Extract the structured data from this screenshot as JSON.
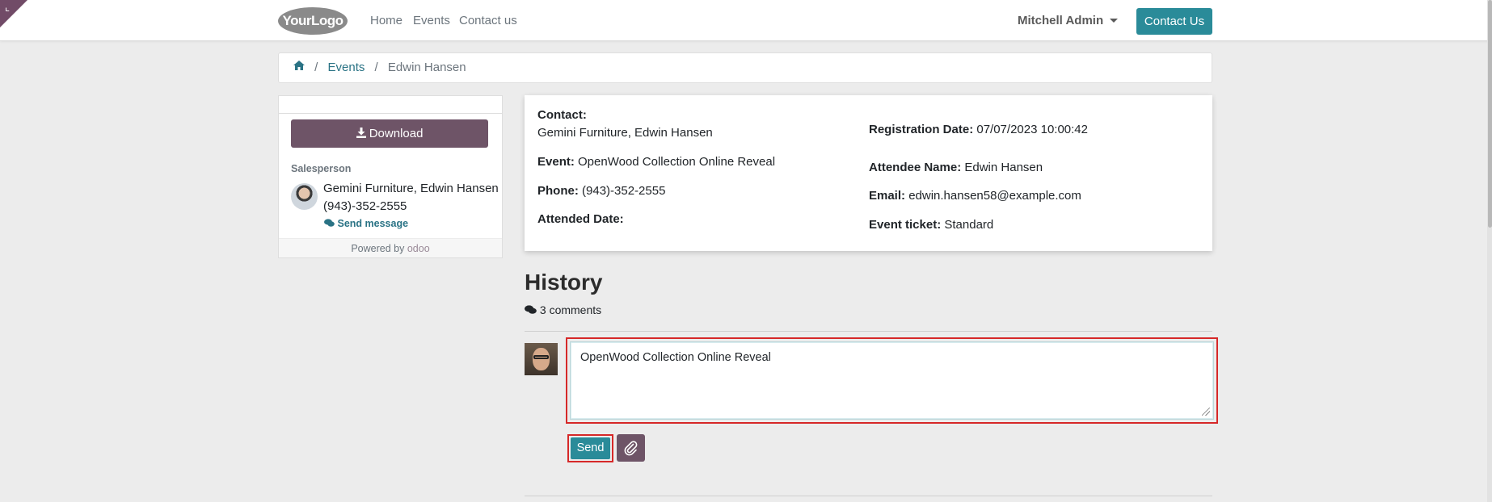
{
  "navbar": {
    "logo_text": "YourLogo",
    "links": [
      "Home",
      "Events",
      "Contact us"
    ],
    "user_name": "Mitchell Admin",
    "contact_button": "Contact Us",
    "accent_color": "#2a8b99",
    "brand_color": "#714b67"
  },
  "breadcrumb": {
    "items": [
      "Events",
      "Edwin Hansen"
    ]
  },
  "sidebar": {
    "download_label": "Download",
    "salesperson_label": "Salesperson",
    "salesperson_name": "Gemini Furniture, Edwin Hansen",
    "salesperson_phone": "(943)-352-2555",
    "send_message_label": "Send message",
    "powered_by_label": "Powered by",
    "powered_by_brand": "odoo"
  },
  "registration": {
    "contact_label": "Contact:",
    "contact_value": "Gemini Furniture, Edwin Hansen",
    "event_label": "Event:",
    "event_value": "OpenWood Collection Online Reveal",
    "phone_label": "Phone:",
    "phone_value": "(943)-352-2555",
    "attended_label": "Attended Date:",
    "attended_value": "",
    "reg_date_label": "Registration Date:",
    "reg_date_value": "07/07/2023 10:00:42",
    "attendee_label": "Attendee Name:",
    "attendee_value": "Edwin Hansen",
    "email_label": "Email:",
    "email_value": "edwin.hansen58@example.com",
    "ticket_label": "Event ticket:",
    "ticket_value": "Standard"
  },
  "history": {
    "title": "History",
    "comments_count": "3 comments",
    "composer_value": "OpenWood Collection Online Reveal ",
    "send_label": "Send"
  }
}
